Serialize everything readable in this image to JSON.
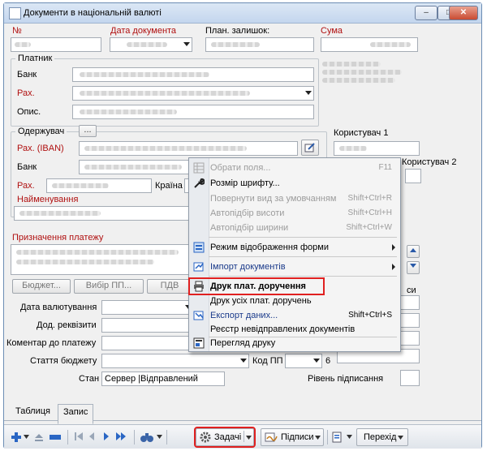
{
  "window": {
    "title": "Документи в національній валюті"
  },
  "header": {
    "num_label": "№",
    "date_label": "Дата документа",
    "balance_label": "План. залишок:",
    "sum_label": "Сума"
  },
  "payer": {
    "group_label": "Платник",
    "bank_label": "Банк",
    "account_label": "Рах.",
    "desc_label": "Опис."
  },
  "receiver": {
    "group_label": "Одержувач",
    "more_btn": "...",
    "iban_label": "Рах. (IBAN)",
    "bank_label": "Банк",
    "account_label": "Рах.",
    "country_label": "Країна",
    "name_label": "Найменування",
    "user1_label": "Користувач 1",
    "user2_label": "Користувач 2"
  },
  "purpose": {
    "label": "Призначення платежу"
  },
  "buttons": {
    "budget": "Бюджет...",
    "choose_pp": "Вибір ПП...",
    "pdv": "ПДВ"
  },
  "form": {
    "valuation_date": "Дата валютування",
    "extra_requisites": "Дод. реквізити",
    "payment_comment": "Коментар до платежу",
    "budget_article": "Стаття бюджету",
    "kod_pp": "Код ПП",
    "kod_value": "6",
    "state_label": "Стан",
    "state_value": "Сервер |Відправлений",
    "sign_level": "Рівень підписання",
    "right_group_tail": "си"
  },
  "context_menu": {
    "items": [
      {
        "label": "Обрати поля...",
        "shortcut": "F11",
        "disabled": true,
        "icon": "grid-icon"
      },
      {
        "label": "Розмір шрифту...",
        "shortcut": "",
        "disabled": false,
        "icon": "wrench-icon"
      },
      {
        "label": "Повернути вид за умовчанням",
        "shortcut": "Shift+Ctrl+R",
        "disabled": true,
        "icon": ""
      },
      {
        "label": "Автопідбір висоти",
        "shortcut": "Shift+Ctrl+H",
        "disabled": true,
        "icon": ""
      },
      {
        "label": "Автопідбір ширини",
        "shortcut": "Shift+Ctrl+W",
        "disabled": true,
        "icon": ""
      },
      {
        "label": "Режим відображення форми",
        "shortcut": "",
        "disabled": false,
        "icon": "form-icon"
      },
      {
        "label": "Імпорт документів",
        "shortcut": "",
        "disabled": false,
        "icon": "import-icon"
      },
      {
        "label": "Друк плат. доручення",
        "shortcut": "",
        "disabled": false,
        "icon": "printer-icon"
      },
      {
        "label": "Друк усіх плат. доручень",
        "shortcut": "",
        "disabled": false,
        "icon": ""
      },
      {
        "label": "Експорт даних...",
        "shortcut": "Shift+Ctrl+S",
        "disabled": false,
        "icon": "export-icon"
      },
      {
        "label": "Реєстр невідправлених документів",
        "shortcut": "",
        "disabled": false,
        "icon": ""
      },
      {
        "label": "Перегляд друку",
        "shortcut": "",
        "disabled": false,
        "icon": "preview-icon"
      }
    ]
  },
  "tabs": [
    "Таблиця",
    "Запис"
  ],
  "toolbar": {
    "tasks": "Задачі",
    "signatures": "Підписи",
    "transition": "Перехід"
  },
  "colors": {
    "title_bar": "#c4d6ee",
    "highlight": "#e02020",
    "label_red": "#b01010"
  }
}
